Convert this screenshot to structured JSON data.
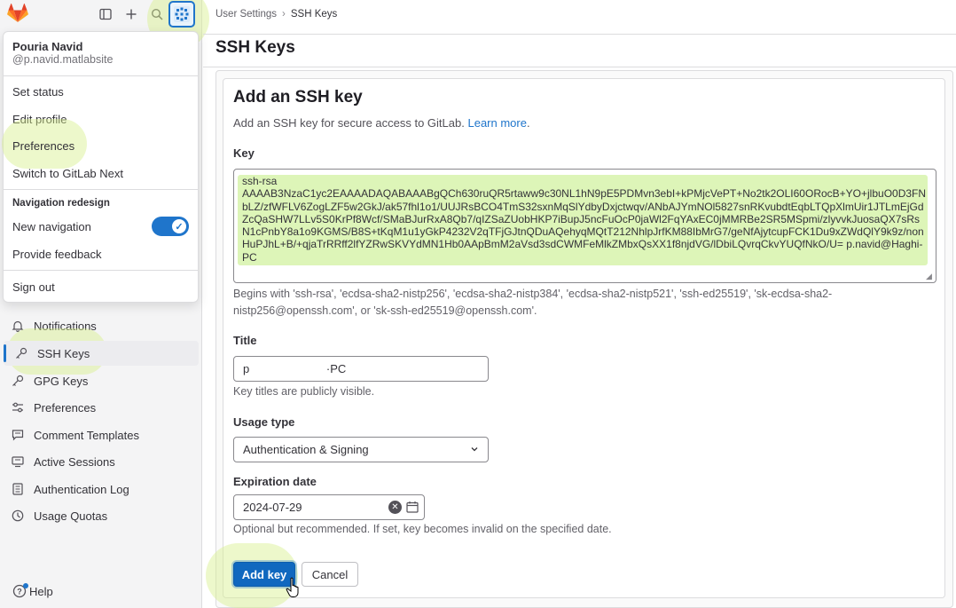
{
  "user": {
    "name": "Pouria Navid",
    "handle": "@p.navid.matlabsite"
  },
  "user_menu": {
    "items": [
      "Set status",
      "Edit profile",
      "Preferences",
      "Switch to GitLab Next"
    ],
    "nav_redesign_heading": "Navigation redesign",
    "new_navigation_label": "New navigation",
    "new_navigation_enabled": true,
    "feedback": "Provide feedback",
    "sign_out": "Sign out"
  },
  "sidebar": {
    "items": [
      {
        "label": "Notifications",
        "icon": "bell-icon"
      },
      {
        "label": "SSH Keys",
        "icon": "key-icon",
        "active": true
      },
      {
        "label": "GPG Keys",
        "icon": "key-icon"
      },
      {
        "label": "Preferences",
        "icon": "preferences-icon"
      },
      {
        "label": "Comment Templates",
        "icon": "comment-icon"
      },
      {
        "label": "Active Sessions",
        "icon": "monitor-icon"
      },
      {
        "label": "Authentication Log",
        "icon": "log-icon"
      },
      {
        "label": "Usage Quotas",
        "icon": "quota-icon"
      }
    ],
    "help": "Help"
  },
  "breadcrumb": {
    "parent": "User Settings",
    "current": "SSH Keys"
  },
  "page": {
    "title": "SSH Keys"
  },
  "form": {
    "heading": "Add an SSH key",
    "description": "Add an SSH key for secure access to GitLab.",
    "learn_more": "Learn more",
    "learn_more_suffix": ".",
    "key_label": "Key",
    "key_value": "ssh-rsa\nAAAAB3NzaC1yc2EAAAADAQABAAABgQCh630ruQR5rtaww9c30NL1hN9pE5PDMvn3ebI+kPMjcVePT+No2tk2OLI60ORocB+YO+jlbuO0D3FNbLZ/zfWFLV6ZogLZF5w2GkJ/ak57fhl1o1/UUJRsBCO4TmS32sxnMqSlYdbyDxjctwqv/ANbAJYmNOl5827snRKvubdtEqbLTQpXlmUir1JTLmEjGdZcQaSHW7LLv5S0KrPf8Wcf/SMaBJurRxA8Qb7/qIZSaZUobHKP7iBupJ5ncFuOcP0jaWl2FqYAxEC0jMMRBe2SR5MSpmi/zlyvvkJuosaQX7sRsN1cPnbY8a1o9KGMS/B8S+tKqM1u1yGkP4232V2qTFjGJtnQDuAQehyqMQtT212NhlpJrfKM88IbMrG7/geNfAjytcupFCK1Du9xZWdQlY9k9z/nonHuPJhL+B/+qjaTrRRff2lfYZRwSKVYdMN1Hb0AApBmM2aVsd3sdCWMFeMlkZMbxQsXX1f8njdVG/lDbiLQvrqCkvYUQfNkO/U= p.navid@Haghi-PC",
    "key_hint": "Begins with 'ssh-rsa', 'ecdsa-sha2-nistp256', 'ecdsa-sha2-nistp384', 'ecdsa-sha2-nistp521', 'ssh-ed25519', 'sk-ecdsa-sha2-nistp256@openssh.com', or 'sk-ssh-ed25519@openssh.com'.",
    "title_label": "Title",
    "title_value": "p                        ·PC",
    "title_hint": "Key titles are publicly visible.",
    "usage_label": "Usage type",
    "usage_value": "Authentication & Signing",
    "expiration_label": "Expiration date",
    "expiration_value": "2024-07-29",
    "expiration_hint": "Optional but recommended. If set, key becomes invalid on the specified date.",
    "submit": "Add key",
    "cancel": "Cancel"
  },
  "colors": {
    "primary": "#1068bf",
    "highlight": "#ddf5b8",
    "toggle_on": "#1f75cb"
  }
}
